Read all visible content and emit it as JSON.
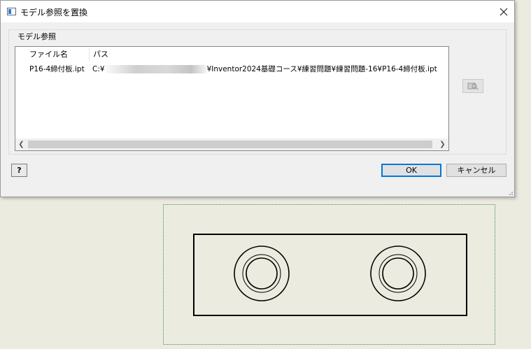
{
  "dialog": {
    "title": "モデル参照を置換",
    "group_label": "モデル参照",
    "columns": [
      "ファイル名",
      "パス"
    ],
    "rows": [
      {
        "filename": "P16-4締付板.ipt",
        "path_prefix": "C:¥",
        "path_suffix": "¥Inventor2024基礎コース¥練習問題¥練習問題-16¥P16-4締付板.ipt"
      }
    ],
    "ok_label": "OK",
    "cancel_label": "キャンセル",
    "help_icon_text": "?"
  },
  "icons": {
    "close": "close-icon",
    "help": "help-icon",
    "browse": "browse-icon",
    "app": "app-icon",
    "scroll_left": "chevron-left-icon",
    "scroll_right": "chevron-right-icon"
  },
  "colors": {
    "canvas_bg": "#ecebe0",
    "accent": "#0078d7",
    "sheet_border": "#4a8a4a"
  }
}
